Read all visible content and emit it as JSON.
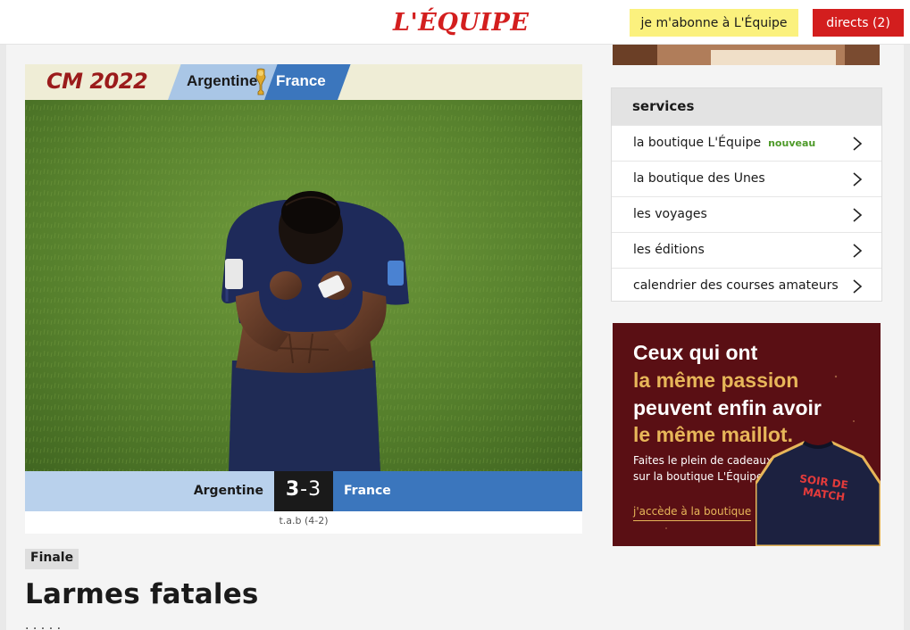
{
  "header": {
    "logo": "L'ÉQUIPE",
    "subscribe_label": "je m'abonne à L'Équipe",
    "directs_label": "directs (2)"
  },
  "match_banner": {
    "competition": "CM 2022",
    "team_home": "Argentine",
    "team_away": "France"
  },
  "scoreboard": {
    "team_home": "Argentine",
    "score_home": "3",
    "separator": "-",
    "score_away": "3",
    "team_away": "France",
    "tiebreak": "t.a.b (4-2)"
  },
  "article": {
    "tag": "Finale",
    "headline": "Larmes fatales",
    "lead_partial": "·  ·  ·  ·  ·"
  },
  "services": {
    "title": "services",
    "items": [
      {
        "label": "la boutique L'Équipe",
        "badge": "nouveau"
      },
      {
        "label": "la boutique des Unes",
        "badge": ""
      },
      {
        "label": "les voyages",
        "badge": ""
      },
      {
        "label": "les éditions",
        "badge": ""
      },
      {
        "label": "calendrier des courses amateurs",
        "badge": ""
      }
    ]
  },
  "ad": {
    "line1": "Ceux qui ont",
    "line2": "la même passion",
    "line3": "peuvent enfin avoir",
    "line4": "le même maillot.",
    "body1": "Faites le plein de cadeaux",
    "body2": "sur la boutique L'Équipe.",
    "cta": "j'accède à la boutique",
    "shirt_text_1": "SOIR DE",
    "shirt_text_2": "MATCH"
  },
  "colors": {
    "brand_red": "#d31e1e",
    "subscribe_yellow": "#fbf17e",
    "argentina_blue": "#b9d1ec",
    "france_blue": "#3b76bd",
    "ad_bg": "#5a0f14",
    "ad_gold": "#e7b659",
    "nouveau_green": "#4e9a29"
  }
}
